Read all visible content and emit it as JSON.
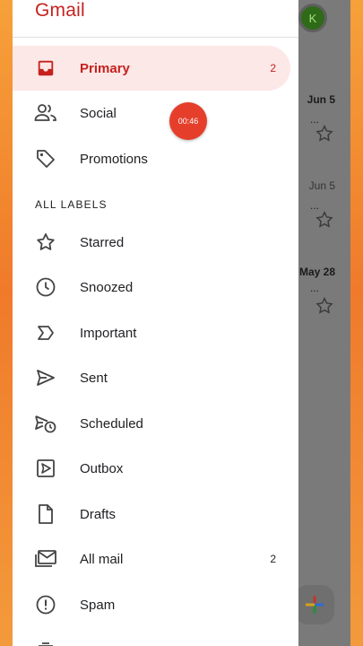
{
  "app": {
    "title": "Gmail"
  },
  "background": {
    "avatar_letter": "K",
    "dates": [
      "Jun 5",
      "Jun 5",
      "May 28"
    ]
  },
  "drawer": {
    "items_top": [
      {
        "label": "Primary",
        "icon": "inbox-icon",
        "count": "2",
        "active": true
      },
      {
        "label": "Social",
        "icon": "people-icon"
      },
      {
        "label": "Promotions",
        "icon": "tag-icon"
      }
    ],
    "section_header": "ALL LABELS",
    "labels": [
      {
        "label": "Starred",
        "icon": "star-icon"
      },
      {
        "label": "Snoozed",
        "icon": "clock-icon"
      },
      {
        "label": "Important",
        "icon": "important-icon"
      },
      {
        "label": "Sent",
        "icon": "send-icon"
      },
      {
        "label": "Scheduled",
        "icon": "scheduled-send-icon"
      },
      {
        "label": "Outbox",
        "icon": "outbox-icon"
      },
      {
        "label": "Drafts",
        "icon": "draft-icon"
      },
      {
        "label": "All mail",
        "icon": "all-mail-icon",
        "count": "2"
      },
      {
        "label": "Spam",
        "icon": "spam-icon"
      }
    ]
  },
  "overlay": {
    "timer": "00:46"
  },
  "colors": {
    "accent": "#c5221f",
    "active_bg": "#fce8e6",
    "timer_bg": "#e53f2b"
  }
}
